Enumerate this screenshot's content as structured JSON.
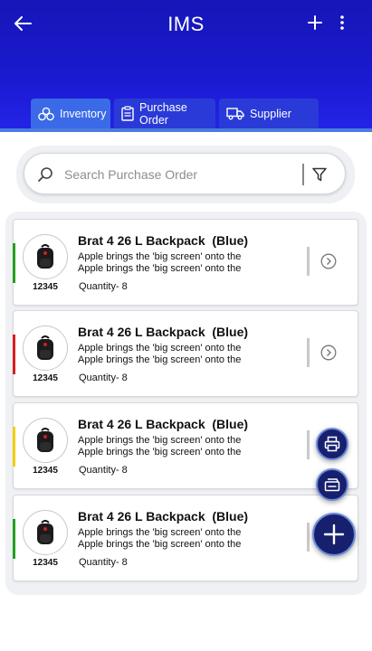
{
  "header": {
    "title": "IMS",
    "back_icon": "arrow-left-icon",
    "add_icon": "plus-icon",
    "more_icon": "more-vertical-icon",
    "color": "#1a1ad0"
  },
  "tabs": [
    {
      "label": "Inventory",
      "icon": "boxes-icon",
      "active": true
    },
    {
      "label": "Purchase Order",
      "icon": "clipboard-icon",
      "active": false
    },
    {
      "label": "Supplier",
      "icon": "truck-icon",
      "active": false
    }
  ],
  "search": {
    "placeholder": "Search Purchase Order",
    "value": ""
  },
  "items": [
    {
      "title": "Brat 4 26 L Backpack  (Blue)",
      "desc1": "Apple brings the 'big screen' onto the",
      "desc2": "Apple brings the 'big screen' onto the",
      "quantity": "Quantity- 8",
      "code": "12345",
      "status_color": "#22a020"
    },
    {
      "title": "Brat 4 26 L Backpack  (Blue)",
      "desc1": "Apple brings the 'big screen' onto the",
      "desc2": "Apple brings the 'big screen' onto the",
      "quantity": "Quantity- 8",
      "code": "12345",
      "status_color": "#d81e1e"
    },
    {
      "title": "Brat 4 26 L Backpack  (Blue)",
      "desc1": "Apple brings the 'big screen' onto the",
      "desc2": "Apple brings the 'big screen' onto the",
      "quantity": "Quantity- 8",
      "code": "12345",
      "status_color": "#f0d000"
    },
    {
      "title": "Brat 4 26 L Backpack  (Blue)",
      "desc1": "Apple brings the 'big screen' onto the",
      "desc2": "Apple brings the 'big screen' onto the",
      "quantity": "Quantity- 8",
      "code": "12345",
      "status_color": "#22a020"
    }
  ],
  "fabs": [
    {
      "icon": "printer-icon"
    },
    {
      "icon": "scanner-icon"
    },
    {
      "icon": "plus-icon"
    }
  ]
}
